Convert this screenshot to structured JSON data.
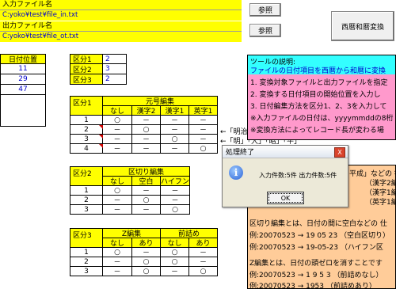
{
  "input_file": {
    "label": "入力ファイル名",
    "path": "C:yoko¥test¥file_in.txt",
    "browse": "参照"
  },
  "output_file": {
    "label": "出力ファイル名",
    "path": "C:yoko¥test¥file_ot.txt",
    "browse": "参照"
  },
  "convert_button": "西暦和暦変換",
  "date_pos": {
    "header": "日付位置",
    "values": [
      "11",
      "29",
      "47"
    ]
  },
  "categories": {
    "rows": [
      {
        "label": "区分1",
        "value": "2"
      },
      {
        "label": "区分2",
        "value": "3"
      },
      {
        "label": "区分3",
        "value": "2"
      }
    ]
  },
  "table1": {
    "label": "区分1",
    "group": "元号編集",
    "cols": [
      "なし",
      "漢字2",
      "漢字1",
      "英字1"
    ],
    "rows": [
      {
        "n": "1",
        "cells": [
          "○",
          "－",
          "－",
          "－"
        ]
      },
      {
        "n": "2",
        "cells": [
          "－",
          "○",
          "－",
          "－"
        ]
      },
      {
        "n": "3",
        "cells": [
          "－",
          "－",
          "○",
          "－"
        ]
      },
      {
        "n": "4",
        "cells": [
          "－",
          "－",
          "－",
          "○"
        ]
      }
    ],
    "notes": [
      "←「明治」「大正」「昭和」「平成」",
      "←「明」「大」「昭」「平」"
    ]
  },
  "table2": {
    "label": "区分2",
    "group": "区切り編集",
    "cols": [
      "なし",
      "空白",
      "ハイフン"
    ],
    "rows": [
      {
        "n": "1",
        "cells": [
          "○",
          "－",
          "－"
        ]
      },
      {
        "n": "2",
        "cells": [
          "－",
          "○",
          "－"
        ]
      },
      {
        "n": "3",
        "cells": [
          "－",
          "－",
          "○"
        ]
      }
    ]
  },
  "table3": {
    "label": "区分3",
    "group1": "Z編集",
    "group2": "前詰め",
    "cols": [
      "なし",
      "あり",
      "なし",
      "あり"
    ],
    "rows": [
      {
        "n": "1",
        "cells": [
          "○",
          "－",
          "○",
          "－"
        ]
      },
      {
        "n": "2",
        "cells": [
          "－",
          "○",
          "○",
          "－"
        ]
      },
      {
        "n": "3",
        "cells": [
          "－",
          "○",
          "－",
          "○"
        ]
      }
    ]
  },
  "tool_desc": {
    "heading": "ツールの説明:",
    "line2": "ファイルの日付項目を西暦から和暦に変換",
    "pink_lines": [
      "1. 変換対象ファイルと出力ファイルを指定",
      "2. 変換する日付項目の開始位置を入力し",
      "3. 日付編集方法を区分1、2、3を入力して",
      "※入力ファイルの日付は、yyyymmddの8桁",
      "※変換方法によってレコード長が変わる場"
    ]
  },
  "orange_top": [
    "平成」などの 符",
    "（漢字2編",
    "（漢字1編",
    "（英字1編"
  ],
  "orange_bottom": [
    "区切り編集とは、日付の間に空白などの 仕",
    "例:20070523 → 19 05 23 （空白区切り）",
    "例:20070523 → 19-05-23 （ハイフン区",
    "",
    "Z編集とは、日付の頭ゼロを消すことです",
    "例:20070523 → 1 9 5 3 （前詰めなし）",
    "例:20070523 → 1953 （前詰めあり）"
  ],
  "dialog": {
    "title": "処理終了",
    "message": "入力件数:5件 出力件数:5件",
    "ok": "OK",
    "close": "X"
  }
}
